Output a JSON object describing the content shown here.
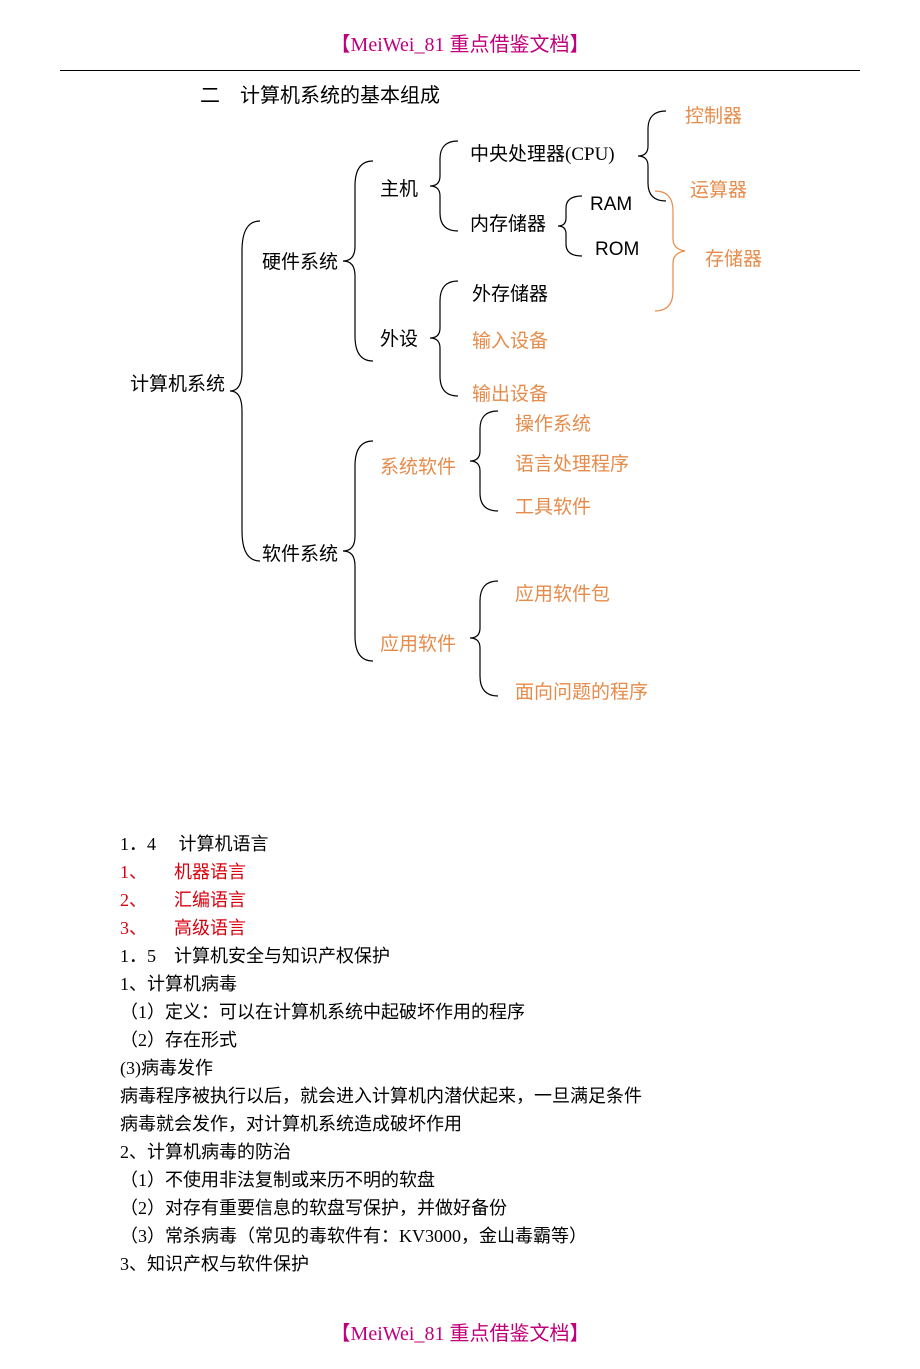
{
  "header": "【MeiWei_81 重点借鉴文档】",
  "footer": "【MeiWei_81 重点借鉴文档】",
  "title": "二　计算机系统的基本组成",
  "nodes": {
    "root": "计算机系统",
    "hw": "硬件系统",
    "sw": "软件系统",
    "host": "主机",
    "periph": "外设",
    "cpu": "中央处理器(CPU)",
    "mem_in": "内存储器",
    "ram": "RAM",
    "rom": "ROM",
    "ctrl": "控制器",
    "alu": "运算器",
    "storage": "存储器",
    "ext_store": "外存储器",
    "in_dev": "输入设备",
    "out_dev": "输出设备",
    "sys_sw": "系统软件",
    "app_sw": "应用软件",
    "os": "操作系统",
    "lang_proc": "语言处理程序",
    "tool_sw": "工具软件",
    "app_pack": "应用软件包",
    "prob_prog": "面向问题的程序"
  },
  "body": {
    "l1": "1．4　 计算机语言",
    "l2a": "1、",
    "l2b": "机器语言",
    "l3a": "2、",
    "l3b": "汇编语言",
    "l4a": "3、",
    "l4b": "高级语言",
    "l5": "1．5　计算机安全与知识产权保护",
    "l6": "1、计算机病毒",
    "l7": "（1）定义：可以在计算机系统中起破坏作用的程序",
    "l8": "（2）存在形式",
    "l9": " (3)病毒发作",
    "l10": "病毒程序被执行以后，就会进入计算机内潜伏起来，一旦满足条件",
    "l11": "病毒就会发作，对计算机系统造成破坏作用",
    "l12": "2、计算机病毒的防治",
    "l13": "（1）不使用非法复制或来历不明的软盘",
    "l14": "（2）对存有重要信息的软盘写保护，并做好备份",
    "l15": "（3）常杀病毒（常见的毒软件有：KV3000，金山毒霸等）",
    "l16": "3、知识产权与软件保护"
  }
}
